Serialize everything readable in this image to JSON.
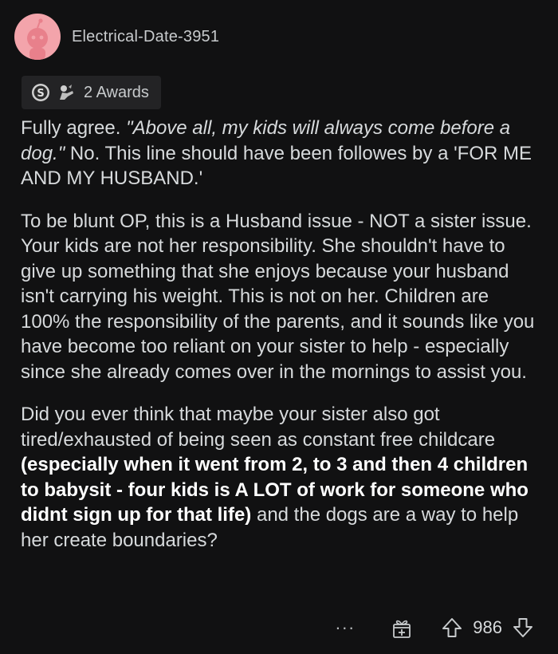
{
  "comment": {
    "username": "Electrical-Date-3951",
    "awards_label": "2 Awards",
    "paragraph1": {
      "text1": "Fully agree. ",
      "italic": "\"Above all, my kids will always come before a dog.\"",
      "text2": " No. This line should have been followes by a 'FOR ME AND MY HUSBAND.'"
    },
    "paragraph2": "To be blunt OP, this is a Husband issue - NOT a sister issue. Your kids are not her responsibility. She shouldn't have to give up something that she enjoys because your husband isn't carrying his weight. This is not on her. Children are 100% the responsibility of the parents, and it sounds like you have become too reliant on your sister to help - especially since she already comes over in the mornings to assist you.",
    "paragraph3": {
      "text1": "Did you ever think that maybe your sister also got tired/exhausted of being seen as constant free childcare ",
      "bold": "(especially when it went from 2, to 3 and then 4 children to babysit - four kids is A LOT of work for someone who didnt sign up for that life)",
      "text2": " and the dogs are a way to help her create boundaries?"
    },
    "footer": {
      "more_label": "···",
      "score": "986"
    }
  },
  "icons": {
    "avatar": "reddit-snoo-icon",
    "award1": "silver-award-icon",
    "award2": "helpful-award-icon",
    "more": "more-options-icon",
    "gift": "gift-award-icon",
    "upvote": "upvote-arrow-icon",
    "downvote": "downvote-arrow-icon"
  },
  "colors": {
    "background": "#111112",
    "avatar_bg": "#f3a4ab",
    "text": "#d7dadc",
    "award_pill": "#232325"
  }
}
